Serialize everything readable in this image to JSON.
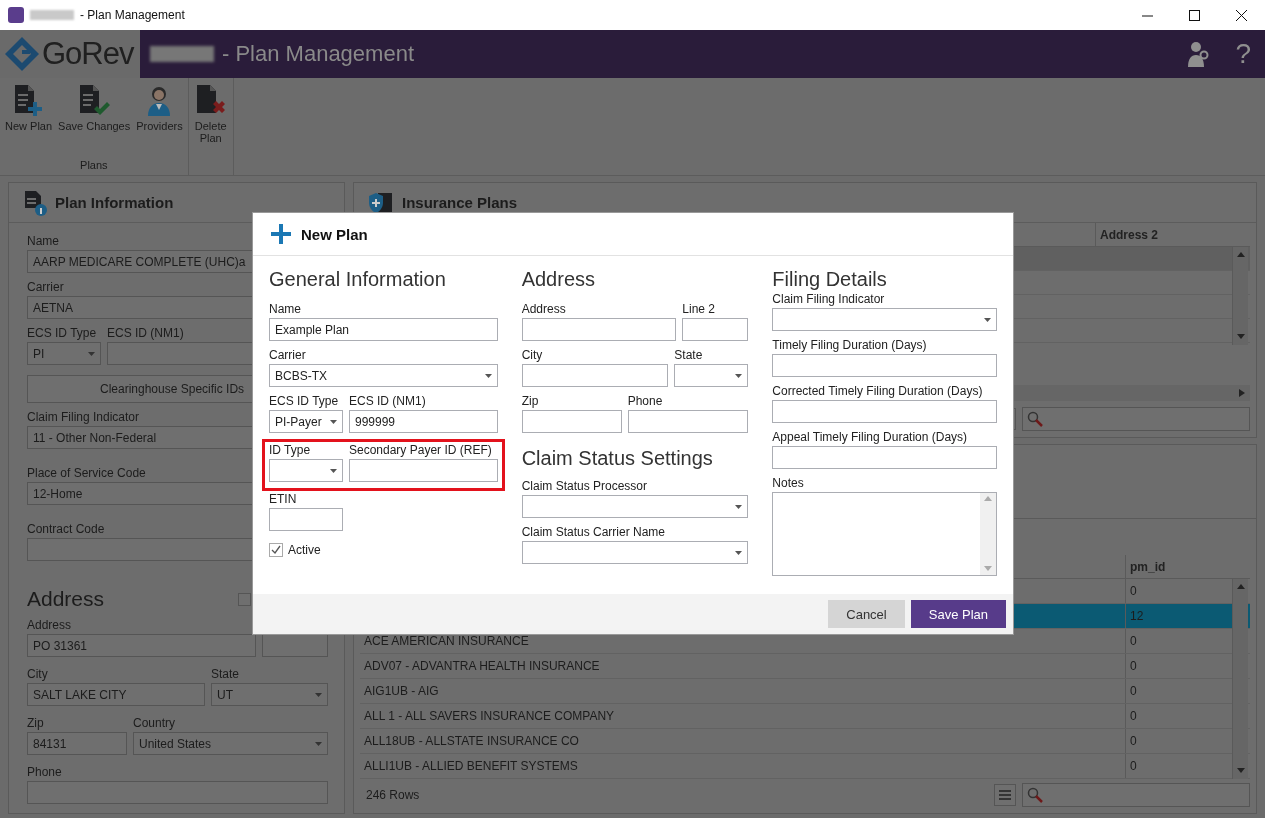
{
  "window": {
    "title": "- Plan Management"
  },
  "header": {
    "logo": "GoRev",
    "title": "- Plan Management",
    "help": "?"
  },
  "ribbon": {
    "buttons": [
      {
        "label": "New Plan",
        "kind": "new"
      },
      {
        "label": "Save Changes",
        "kind": "save"
      },
      {
        "label": "Providers",
        "kind": "providers"
      },
      {
        "label": "Delete Plan",
        "kind": "delete"
      }
    ],
    "group": "Plans"
  },
  "plan_info": {
    "title": "Plan Information",
    "name": {
      "label": "Name",
      "kind": "text",
      "value": "AARP MEDICARE COMPLETE (UHC)a"
    },
    "carrier": {
      "label": "Carrier",
      "kind": "select",
      "value": "AETNA"
    },
    "ecs_id_type": {
      "label": "ECS ID Type",
      "kind": "select",
      "value": "PI"
    },
    "ecs_id": {
      "label": "ECS ID (NM1)",
      "kind": "text"
    },
    "clearinghouse_button": "Clearinghouse Specific IDs",
    "claim_filing_indicator": {
      "label": "Claim Filing Indicator",
      "kind": "text",
      "value": "11 - Other Non-Federal"
    },
    "place_of_service": {
      "label": "Place of Service Code",
      "kind": "text",
      "value": "12-Home"
    },
    "contract_code": {
      "label": "Contract Code",
      "kind": "text"
    },
    "address_title": "Address",
    "address_checked": false,
    "address": {
      "label": "Address",
      "kind": "text",
      "value": "PO 31361"
    },
    "line2": {
      "kind": "text"
    },
    "city": {
      "label": "City",
      "kind": "text",
      "value": "SALT LAKE CITY"
    },
    "state": {
      "label": "State",
      "kind": "select",
      "value": "UT"
    },
    "zip": {
      "label": "Zip",
      "kind": "text",
      "value": "84131"
    },
    "country": {
      "label": "Country",
      "kind": "select",
      "value": "United States"
    },
    "phone": {
      "label": "Phone",
      "kind": "text"
    }
  },
  "insurance_plans": {
    "title": "Insurance Plans",
    "columns": [
      "Address 2"
    ]
  },
  "plans_table": {
    "columns": [
      "pm_id"
    ],
    "rows": [
      {
        "pm_id": "0",
        "selected": false
      },
      {
        "pm_id": "12",
        "selected": true
      },
      {
        "name": "ACE AMERICAN INSURANCE",
        "pm_id": "0",
        "selected": false
      },
      {
        "name": "ADV07 - ADVANTRA HEALTH INSURANCE",
        "pm_id": "0",
        "selected": false
      },
      {
        "name": "AIG1UB - AIG",
        "pm_id": "0",
        "selected": false
      },
      {
        "name": "ALL 1 - ALL SAVERS INSURANCE COMPANY",
        "pm_id": "0",
        "selected": false
      },
      {
        "name": "ALL18UB - ALLSTATE INSURANCE CO",
        "pm_id": "0",
        "selected": false
      },
      {
        "name": "ALLI1UB - ALLIED BENEFIT SYSTEMS",
        "pm_id": "0",
        "selected": false
      }
    ],
    "row_count": "246 Rows"
  },
  "dialog": {
    "title": "New Plan",
    "general": {
      "title": "General Information",
      "name": {
        "label": "Name",
        "kind": "text",
        "value": "Example Plan"
      },
      "carrier": {
        "label": "Carrier",
        "kind": "select",
        "value": "BCBS-TX"
      },
      "ecs_id_type": {
        "label": "ECS ID Type",
        "kind": "select",
        "value": "PI-Payer"
      },
      "ecs_id": {
        "label": "ECS ID (NM1)",
        "kind": "text",
        "value": "999999"
      },
      "id_type": {
        "label": "ID Type",
        "kind": "select"
      },
      "secondary_payer_id": {
        "label": "Secondary Payer ID (REF)",
        "kind": "text"
      },
      "etin": {
        "label": "ETIN",
        "kind": "text"
      },
      "active": {
        "label": "Active",
        "checked": true
      }
    },
    "address": {
      "title": "Address",
      "address": {
        "label": "Address",
        "kind": "text"
      },
      "line2": {
        "label": "Line 2",
        "kind": "text"
      },
      "city": {
        "label": "City",
        "kind": "text"
      },
      "state": {
        "label": "State",
        "kind": "select"
      },
      "zip": {
        "label": "Zip",
        "kind": "text"
      },
      "phone": {
        "label": "Phone",
        "kind": "text"
      }
    },
    "claim_status": {
      "title": "Claim Status Settings",
      "processor": {
        "label": "Claim Status Processor",
        "kind": "select"
      },
      "carrier_name": {
        "label": "Claim Status Carrier Name",
        "kind": "select"
      }
    },
    "filing": {
      "title": "Filing Details",
      "claim_filing_indicator": {
        "label": "Claim Filing Indicator",
        "kind": "select"
      },
      "timely": {
        "label": "Timely Filing Duration (Days)",
        "kind": "text"
      },
      "corrected": {
        "label": "Corrected Timely Filing Duration (Days)",
        "kind": "text"
      },
      "appeal": {
        "label": "Appeal Timely Filing Duration (Days)",
        "kind": "text"
      },
      "notes": {
        "label": "Notes",
        "kind": "textarea"
      }
    },
    "buttons": [
      {
        "label": "Cancel",
        "kind": "secondary"
      },
      {
        "label": "Save Plan",
        "kind": "primary"
      }
    ]
  }
}
